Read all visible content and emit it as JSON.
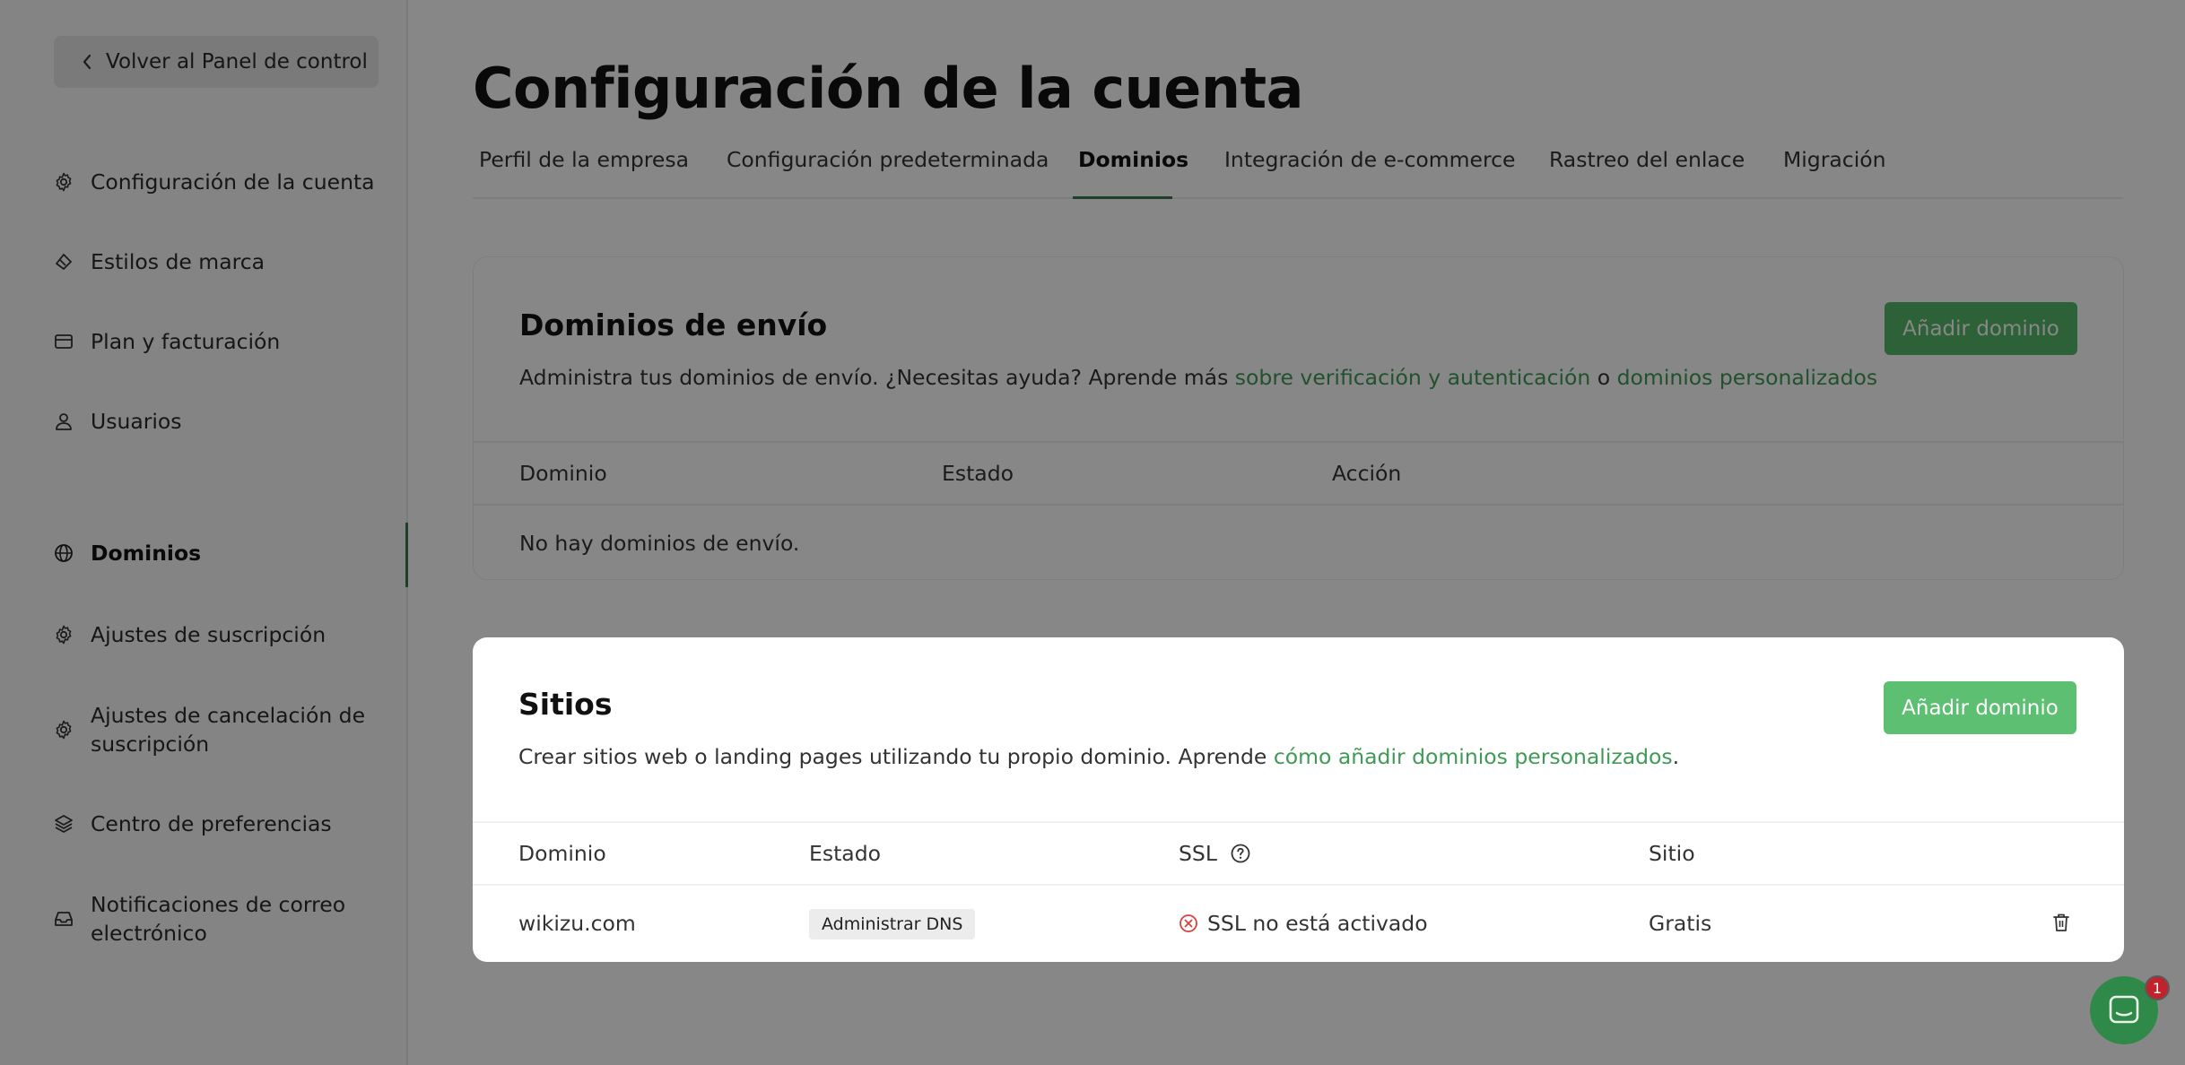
{
  "sidebar": {
    "back_label": "Volver al Panel de control",
    "items": [
      {
        "label": "Configuración de la cuenta",
        "icon": "gear-icon"
      },
      {
        "label": "Estilos de marca",
        "icon": "paint-brush-icon"
      },
      {
        "label": "Plan y facturación",
        "icon": "credit-card-icon"
      },
      {
        "label": "Usuarios",
        "icon": "user-icon"
      },
      {
        "label": "Dominios",
        "icon": "globe-icon"
      },
      {
        "label": "Ajustes de suscripción",
        "icon": "gear-icon"
      },
      {
        "label": "Ajustes de cancelación de suscripción",
        "icon": "gear-icon"
      },
      {
        "label": "Centro de preferencias",
        "icon": "layers-icon"
      },
      {
        "label": "Notificaciones de correo electrónico",
        "icon": "inbox-icon"
      }
    ]
  },
  "header": {
    "title": "Configuración de la cuenta",
    "tabs": [
      {
        "label": "Perfil de la empresa"
      },
      {
        "label": "Configuración predeterminada"
      },
      {
        "label": "Dominios"
      },
      {
        "label": "Integración de e-commerce"
      },
      {
        "label": "Rastreo del enlace"
      },
      {
        "label": "Migración"
      }
    ],
    "active_tab": "Dominios"
  },
  "sending": {
    "title": "Dominios de envío",
    "desc_prefix": "Administra tus dominios de envío. ¿Necesitas ayuda? Aprende más ",
    "link1": "sobre verificación y autenticación",
    "desc_mid": " o ",
    "link2": "dominios personalizados",
    "add_button": "Añadir dominio",
    "columns": {
      "domain": "Dominio",
      "status": "Estado",
      "action": "Acción"
    },
    "empty": "No hay dominios de envío."
  },
  "sites": {
    "title": "Sitios",
    "desc_prefix": "Crear sitios web o landing pages utilizando tu propio dominio. Aprende ",
    "link": "cómo añadir dominios personalizados",
    "desc_suffix": ".",
    "add_button": "Añadir dominio",
    "columns": {
      "domain": "Dominio",
      "status": "Estado",
      "ssl": "SSL",
      "site": "Sitio"
    },
    "row": {
      "domain": "wikizu.com",
      "status_badge": "Administrar DNS",
      "ssl": "SSL no está activado",
      "site": "Gratis"
    }
  },
  "chat": {
    "badge_count": "1"
  },
  "colors": {
    "accent": "#5cbf72",
    "active": "#3b7a4a",
    "error": "#d94040"
  }
}
